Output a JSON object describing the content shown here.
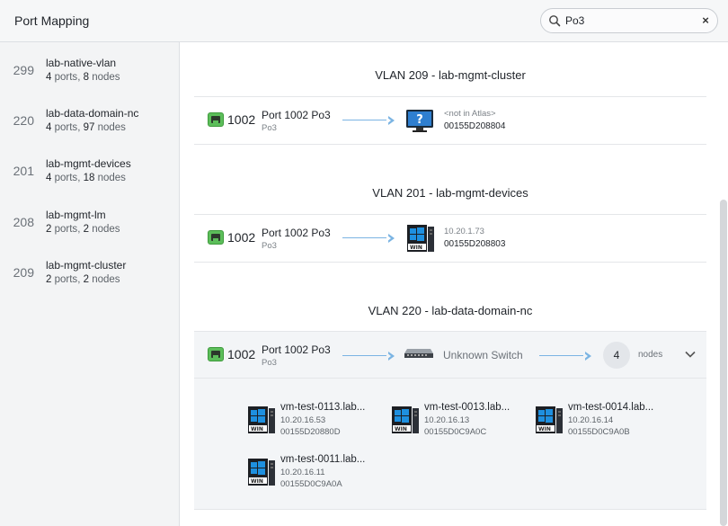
{
  "header": {
    "title": "Port Mapping",
    "search_value": "Po3",
    "clear_label": "×"
  },
  "sidebar": {
    "items": [
      {
        "id": "299",
        "name": "lab-native-vlan",
        "ports": "4",
        "ports_word": "ports",
        "nodes": "8",
        "nodes_word": "nodes"
      },
      {
        "id": "220",
        "name": "lab-data-domain-nc",
        "ports": "4",
        "ports_word": "ports",
        "nodes": "97",
        "nodes_word": "nodes"
      },
      {
        "id": "201",
        "name": "lab-mgmt-devices",
        "ports": "4",
        "ports_word": "ports",
        "nodes": "18",
        "nodes_word": "nodes"
      },
      {
        "id": "208",
        "name": "lab-mgmt-lm",
        "ports": "2",
        "ports_word": "ports",
        "nodes": "2",
        "nodes_word": "nodes"
      },
      {
        "id": "209",
        "name": "lab-mgmt-cluster",
        "ports": "2",
        "ports_word": "ports",
        "nodes": "2",
        "nodes_word": "nodes"
      }
    ]
  },
  "sections": [
    {
      "title": "VLAN 209 - lab-mgmt-cluster",
      "port_num": "1002",
      "port_name": "Port 1002 Po3",
      "port_sub": "Po3",
      "device_line1": "<not in Atlas>",
      "device_line2": "00155D208804"
    },
    {
      "title": "VLAN 201 - lab-mgmt-devices",
      "port_num": "1002",
      "port_name": "Port 1002 Po3",
      "port_sub": "Po3",
      "device_line1": "10.20.1.73",
      "device_line2": "00155D208803"
    },
    {
      "title": "VLAN 220 - lab-data-domain-nc",
      "port_num": "1002",
      "port_name": "Port 1002 Po3",
      "port_sub": "Po3",
      "switch_label": "Unknown Switch",
      "node_count": "4",
      "nodes_label": "nodes",
      "nodes": [
        {
          "name": "vm-test-0113.lab...",
          "ip": "10.20.16.53",
          "mac": "00155D20880D"
        },
        {
          "name": "vm-test-0013.lab...",
          "ip": "10.20.16.13",
          "mac": "00155D0C9A0C"
        },
        {
          "name": "vm-test-0014.lab...",
          "ip": "10.20.16.14",
          "mac": "00155D0C9A0B"
        },
        {
          "name": "vm-test-0011.lab...",
          "ip": "10.20.16.11",
          "mac": "00155D0C9A0A"
        }
      ]
    }
  ],
  "colors": {
    "accent": "#7bb4e3",
    "port_green": "#5cbe5a",
    "windows_blue": "#1e90e0"
  }
}
